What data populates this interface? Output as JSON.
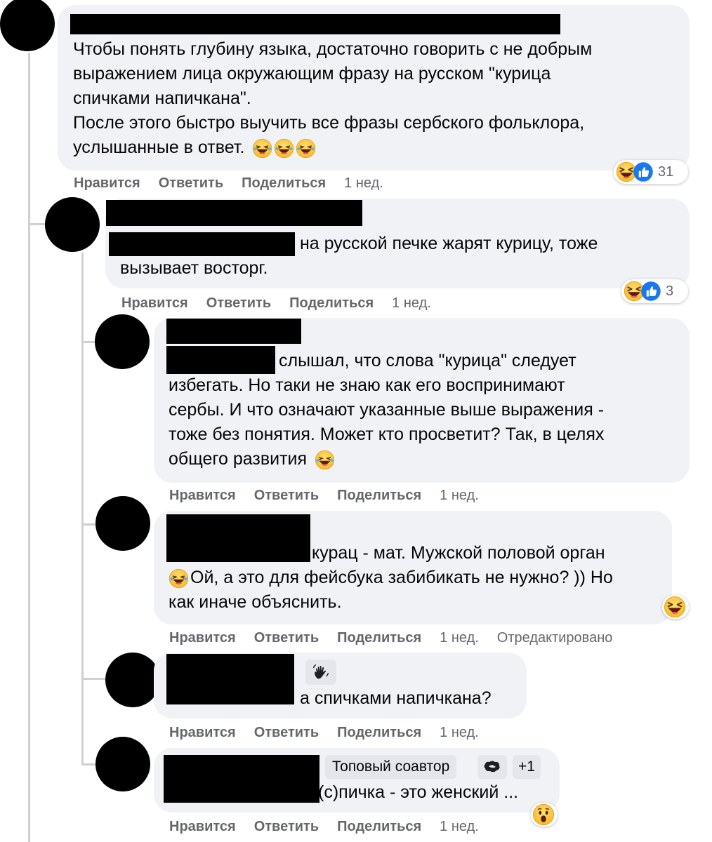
{
  "actions": {
    "like": "Нравится",
    "reply": "Ответить",
    "share": "Поделиться"
  },
  "comments": [
    {
      "lines": [
        "Чтобы понять глубину языка, достаточно говорить с не добрым",
        "выражением лица окружающим фразу на русском \"курица",
        "спичками напичкана\".",
        "После этого быстро выучить все фразы сербского фольклора,",
        "услышанные в ответ."
      ],
      "time": "1 нед.",
      "reaction_count": "31"
    },
    {
      "lines": [
        "на русской печке жарят курицу, тоже",
        "вызывает восторг."
      ],
      "time": "1 нед.",
      "reaction_count": "3"
    },
    {
      "lines": [
        "слышал, что слова \"курица\" следует",
        "избегать. Но таки не знаю как его воспринимают",
        "сербы. И что означают указанные выше выражения -",
        "тоже без понятия. Может кто просветит? Так, в целях",
        "общего развития"
      ],
      "time": "1 нед."
    },
    {
      "lines": [
        "курац - мат. Мужской половой орган",
        "Ой, а это для фейсбука забибикать не нужно? )) Но",
        "как иначе объяснить."
      ],
      "time": "1 нед.",
      "edited": "Отредактировано"
    },
    {
      "lines": [
        "а спичками напичкана?"
      ],
      "time": "1 нед."
    },
    {
      "badge": "Топовый соавтор",
      "badge_extra": "+1",
      "lines": [
        "(с)пичка - это женский ..."
      ],
      "time": "1 нед."
    }
  ],
  "colors": {
    "bubble": "#f0f2f5",
    "secondary_text": "#65676b",
    "like_blue": "#1877f2",
    "emoji_yellow": "#fcc83c"
  },
  "icons": [
    "laughing-emoji-icon",
    "haha-reaction-icon",
    "like-reaction-icon",
    "wow-reaction-icon",
    "waving-hand-icon",
    "top-fan-icon"
  ]
}
